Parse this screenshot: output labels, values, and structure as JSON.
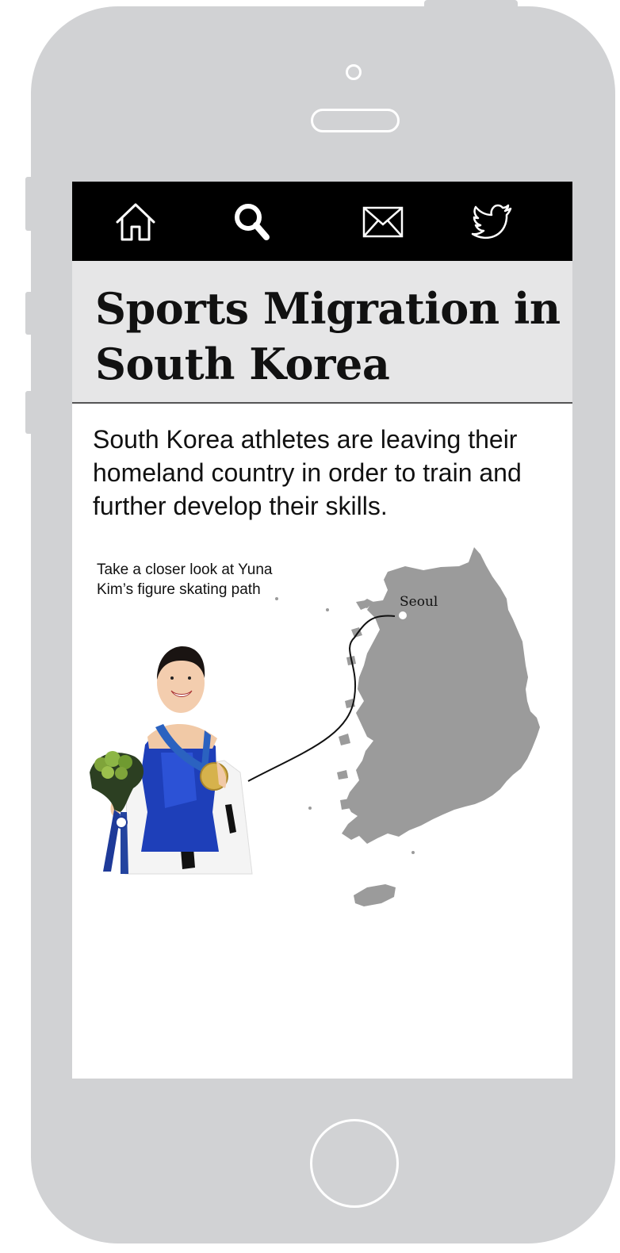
{
  "nav": {
    "items": [
      {
        "icon": "home-icon"
      },
      {
        "icon": "search-icon"
      },
      {
        "icon": "mail-icon"
      },
      {
        "icon": "twitter-icon"
      }
    ]
  },
  "article": {
    "title": "Sports Migration in South Korea",
    "intro": "South Korea athletes are leaving their homeland country in order to train and further develop their skills.",
    "caption": "Take a closer look at Yuna Kim’s figure skating path"
  },
  "map": {
    "city_label": "Seoul"
  },
  "colors": {
    "phone_body": "#d1d2d4",
    "navbar": "#000000",
    "title_band": "#e6e6e7",
    "map_land": "#9b9b9b"
  }
}
